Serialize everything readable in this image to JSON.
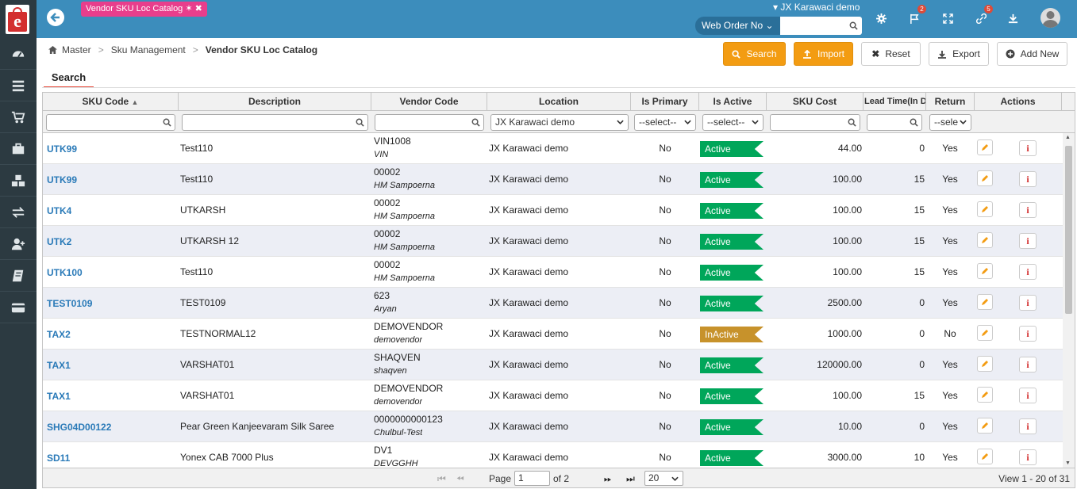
{
  "header": {
    "tab_label": "Vendor SKU Loc Catalog",
    "location": "JX Karawaci demo",
    "weborder_label": "Web Order No",
    "weborder_value": "",
    "flag_badge": "2",
    "link_badge": "5"
  },
  "breadcrumb": {
    "home": "Master",
    "section": "Sku Management",
    "current": "Vendor SKU Loc Catalog"
  },
  "toolbar": {
    "search": "Search",
    "import": "Import",
    "reset": "Reset",
    "export": "Export",
    "add_new": "Add New"
  },
  "search_tab": "Search",
  "columns": {
    "sku": "SKU Code",
    "description": "Description",
    "vendor": "Vendor Code",
    "location": "Location",
    "primary": "Is Primary",
    "active": "Is Active",
    "cost": "SKU Cost",
    "lead": "Lead Time(In Da",
    "return": "Return",
    "actions": "Actions"
  },
  "filters": {
    "location": "JX Karawaci demo",
    "primary": "--select--",
    "active": "--select--",
    "return": "--sele"
  },
  "rows": [
    {
      "sku": "UTK99",
      "desc": "Test110",
      "vcode": "VIN1008",
      "vname": "VIN",
      "loc": "JX Karawaci demo",
      "primary": "No",
      "active": "Active",
      "cost": "44.00",
      "lead": "0",
      "ret": "Yes"
    },
    {
      "sku": "UTK99",
      "desc": "Test110",
      "vcode": "00002",
      "vname": "HM Sampoerna",
      "loc": "JX Karawaci demo",
      "primary": "No",
      "active": "Active",
      "cost": "100.00",
      "lead": "15",
      "ret": "Yes"
    },
    {
      "sku": "UTK4",
      "desc": "UTKARSH",
      "vcode": "00002",
      "vname": "HM Sampoerna",
      "loc": "JX Karawaci demo",
      "primary": "No",
      "active": "Active",
      "cost": "100.00",
      "lead": "15",
      "ret": "Yes"
    },
    {
      "sku": "UTK2",
      "desc": "UTKARSH 12",
      "vcode": "00002",
      "vname": "HM Sampoerna",
      "loc": "JX Karawaci demo",
      "primary": "No",
      "active": "Active",
      "cost": "100.00",
      "lead": "15",
      "ret": "Yes"
    },
    {
      "sku": "UTK100",
      "desc": "Test110",
      "vcode": "00002",
      "vname": "HM Sampoerna",
      "loc": "JX Karawaci demo",
      "primary": "No",
      "active": "Active",
      "cost": "100.00",
      "lead": "15",
      "ret": "Yes"
    },
    {
      "sku": "TEST0109",
      "desc": "TEST0109",
      "vcode": "623",
      "vname": "Aryan",
      "loc": "JX Karawaci demo",
      "primary": "No",
      "active": "Active",
      "cost": "2500.00",
      "lead": "0",
      "ret": "Yes"
    },
    {
      "sku": "TAX2",
      "desc": "TESTNORMAL12",
      "vcode": "DEMOVENDOR",
      "vname": "demovendor",
      "loc": "JX Karawaci demo",
      "primary": "No",
      "active": "InActive",
      "cost": "1000.00",
      "lead": "0",
      "ret": "No"
    },
    {
      "sku": "TAX1",
      "desc": "VARSHAT01",
      "vcode": "SHAQVEN",
      "vname": "shaqven",
      "loc": "JX Karawaci demo",
      "primary": "No",
      "active": "Active",
      "cost": "120000.00",
      "lead": "0",
      "ret": "Yes"
    },
    {
      "sku": "TAX1",
      "desc": "VARSHAT01",
      "vcode": "DEMOVENDOR",
      "vname": "demovendor",
      "loc": "JX Karawaci demo",
      "primary": "No",
      "active": "Active",
      "cost": "100.00",
      "lead": "15",
      "ret": "Yes"
    },
    {
      "sku": "SHG04D00122",
      "desc": " Pear Green Kanjeevaram Silk Saree",
      "vcode": "0000000000123",
      "vname": "Chulbul-Test",
      "loc": "JX Karawaci demo",
      "primary": "No",
      "active": "Active",
      "cost": "10.00",
      "lead": "0",
      "ret": "Yes"
    },
    {
      "sku": "SD11",
      "desc": "Yonex CAB 7000 Plus",
      "vcode": "DV1",
      "vname": "DEVGGHH",
      "loc": "JX Karawaci demo",
      "primary": "No",
      "active": "Active",
      "cost": "3000.00",
      "lead": "10",
      "ret": "Yes"
    }
  ],
  "pager": {
    "page_label": "Page",
    "page_value": "1",
    "of_label": "of 2",
    "page_size": "20",
    "view_text": "View 1 - 20 of 31"
  }
}
